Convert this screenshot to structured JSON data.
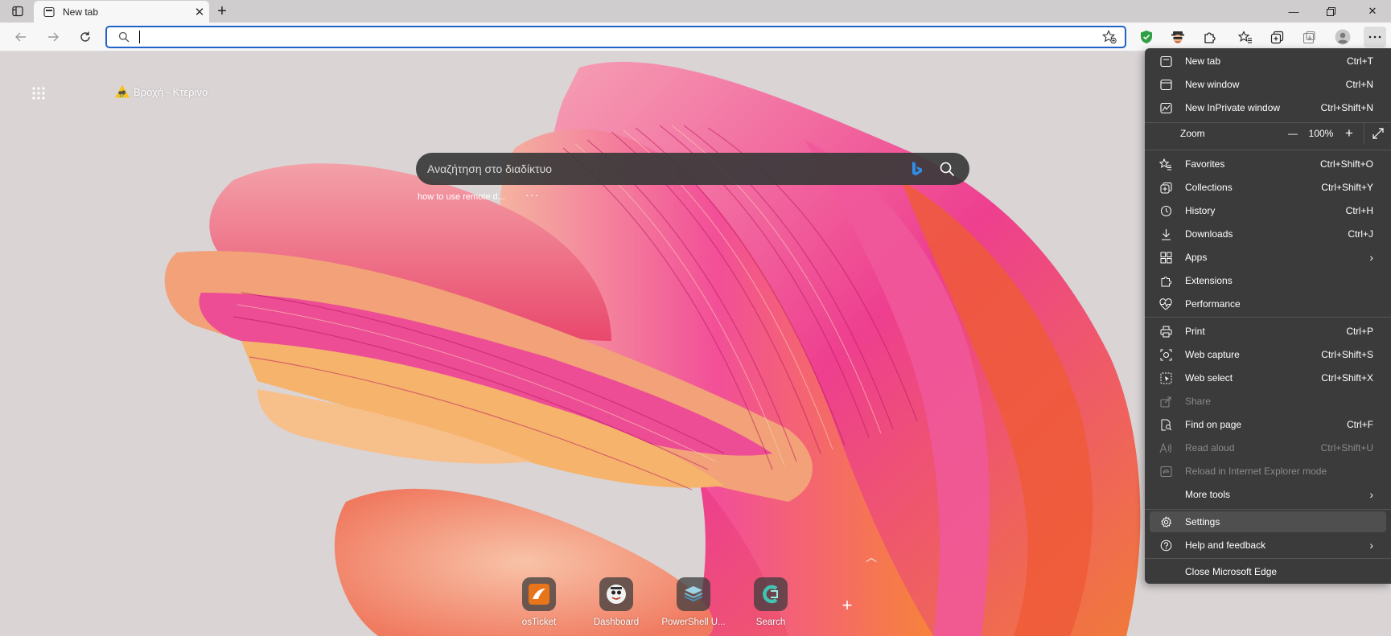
{
  "tab": {
    "title": "New tab"
  },
  "address": {
    "value": "",
    "placeholder": ""
  },
  "page": {
    "weather_text": "Βροχή - Κτερινο",
    "search_placeholder": "Αναζήτηση στο διαδίκτυο",
    "recent_search": "how to use remote d...",
    "recent_more": "···",
    "quick_links": [
      {
        "label": "osTicket"
      },
      {
        "label": "Dashboard"
      },
      {
        "label": "PowerShell U..."
      },
      {
        "label": "Search"
      }
    ],
    "add_link": "+"
  },
  "menu": {
    "new_tab": {
      "label": "New tab",
      "shortcut": "Ctrl+T"
    },
    "new_window": {
      "label": "New window",
      "shortcut": "Ctrl+N"
    },
    "new_inprivate": {
      "label": "New InPrivate window",
      "shortcut": "Ctrl+Shift+N"
    },
    "zoom": {
      "label": "Zoom",
      "value": "100%",
      "minus": "—",
      "plus": "+"
    },
    "favorites": {
      "label": "Favorites",
      "shortcut": "Ctrl+Shift+O"
    },
    "collections": {
      "label": "Collections",
      "shortcut": "Ctrl+Shift+Y"
    },
    "history": {
      "label": "History",
      "shortcut": "Ctrl+H"
    },
    "downloads": {
      "label": "Downloads",
      "shortcut": "Ctrl+J"
    },
    "apps": {
      "label": "Apps"
    },
    "extensions": {
      "label": "Extensions"
    },
    "performance": {
      "label": "Performance"
    },
    "print": {
      "label": "Print",
      "shortcut": "Ctrl+P"
    },
    "web_capture": {
      "label": "Web capture",
      "shortcut": "Ctrl+Shift+S"
    },
    "web_select": {
      "label": "Web select",
      "shortcut": "Ctrl+Shift+X"
    },
    "share": {
      "label": "Share"
    },
    "find_on_page": {
      "label": "Find on page",
      "shortcut": "Ctrl+F"
    },
    "read_aloud": {
      "label": "Read aloud",
      "shortcut": "Ctrl+Shift+U"
    },
    "reload_ie": {
      "label": "Reload in Internet Explorer mode"
    },
    "more_tools": {
      "label": "More tools"
    },
    "settings": {
      "label": "Settings"
    },
    "help": {
      "label": "Help and feedback"
    },
    "close_edge": {
      "label": "Close Microsoft Edge"
    }
  },
  "colors": {
    "menu_bg": "#3b3b3b",
    "address_focus": "#1f64c6",
    "search_bg": "#3a3a3a"
  }
}
